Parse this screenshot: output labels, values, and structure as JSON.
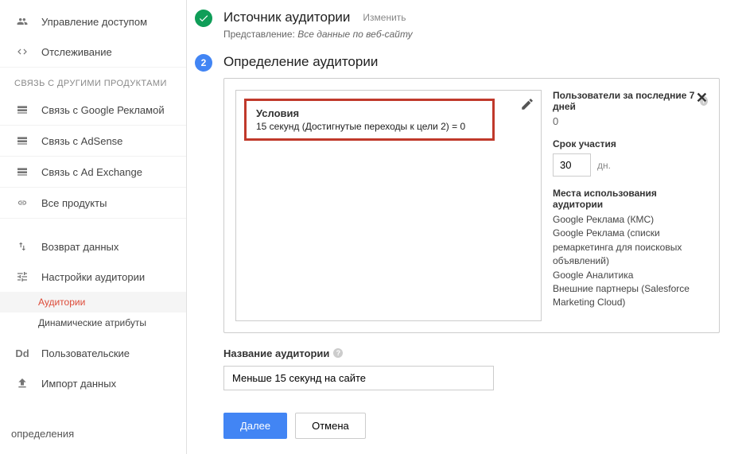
{
  "sidebar": {
    "top_items": [
      {
        "label": "Управление доступом",
        "icon": "people"
      },
      {
        "label": "Отслеживание",
        "icon": "code"
      }
    ],
    "section_header": "СВЯЗЬ С ДРУГИМИ ПРОДУКТАМИ",
    "link_items": [
      {
        "label": "Связь с Google Рекламой",
        "icon": "grid"
      },
      {
        "label": "Связь с AdSense",
        "icon": "grid"
      },
      {
        "label": "Связь с Ad Exchange",
        "icon": "grid"
      },
      {
        "label": "Все продукты",
        "icon": "link"
      }
    ],
    "data_items": [
      {
        "label": "Возврат данных",
        "icon": "arrows"
      },
      {
        "label": "Настройки аудитории",
        "icon": "sliders"
      }
    ],
    "sub_items": [
      {
        "label": "Аудитории",
        "active": true
      },
      {
        "label": "Динамические атрибуты",
        "active": false
      }
    ],
    "custom_item": {
      "label": "Пользовательские",
      "icon": "Dd"
    },
    "import_item": {
      "label": "Импорт данных",
      "icon": "upload"
    },
    "overlay": "определения"
  },
  "step1": {
    "title": "Источник аудитории",
    "change": "Изменить",
    "sub_prefix": "Представление: ",
    "sub_value": "Все данные по веб-сайту"
  },
  "step2": {
    "number": "2",
    "title": "Определение аудитории",
    "conditions_title": "Условия",
    "conditions_text": "15 секунд (Достигнутые переходы к цели 2) = 0"
  },
  "side_panel": {
    "users_label": "Пользователи за последние 7 дней",
    "users_value": "0",
    "duration_label": "Срок участия",
    "duration_value": "30",
    "duration_unit": "дн.",
    "places_label": "Места использования аудитории",
    "places_list": "Google Реклама (КМС)\nGoogle Реклама (списки ремаркетинга для поисковых объявлений)\nGoogle Аналитика\nВнешние партнеры (Salesforce Marketing Cloud)"
  },
  "name_section": {
    "label": "Название аудитории",
    "value": "Меньше 15 секунд на сайте"
  },
  "buttons": {
    "next": "Далее",
    "cancel": "Отмена"
  }
}
